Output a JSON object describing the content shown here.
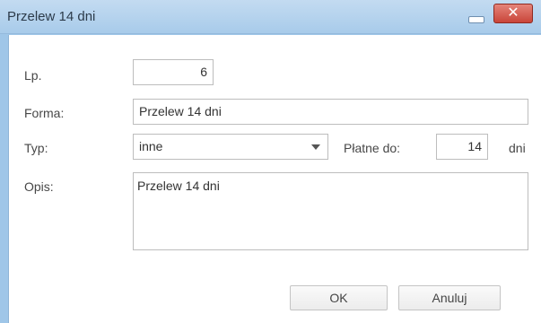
{
  "window": {
    "title": "Przelew 14 dni",
    "close_glyph": "✕",
    "minimize_icon": "minimize-icon",
    "close_icon": "close-icon"
  },
  "form": {
    "lp_label": "Lp.",
    "lp_value": "6",
    "forma_label": "Forma:",
    "forma_value": "Przelew 14 dni",
    "typ_label": "Typ:",
    "typ_value": "inne",
    "platne_label": "Płatne do:",
    "platne_value": "14",
    "dni_label": "dni",
    "opis_label": "Opis:",
    "opis_value": "Przelew 14 dni"
  },
  "buttons": {
    "ok": "OK",
    "cancel": "Anuluj"
  },
  "colors": {
    "titlebar": "#a8cbea",
    "close_button": "#c94539"
  }
}
